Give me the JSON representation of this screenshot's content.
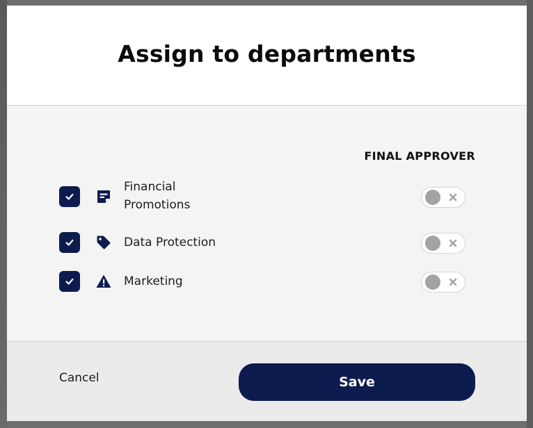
{
  "dialog": {
    "title": "Assign to departments",
    "column_header": "FINAL APPROVER"
  },
  "departments": [
    {
      "label": "Financial Promotions",
      "checked": true,
      "icon": "sticky-note-icon",
      "final_approver": false
    },
    {
      "label": "Data Protection",
      "checked": true,
      "icon": "tag-icon",
      "final_approver": false
    },
    {
      "label": "Marketing",
      "checked": true,
      "icon": "warning-icon",
      "final_approver": false
    }
  ],
  "footer": {
    "cancel_label": "Cancel",
    "save_label": "Save"
  },
  "colors": {
    "primary": "#0d1b4f",
    "body_bg": "#f4f4f4",
    "footer_bg": "#ebebeb",
    "toggle_knob_off": "#a3a3a3"
  }
}
